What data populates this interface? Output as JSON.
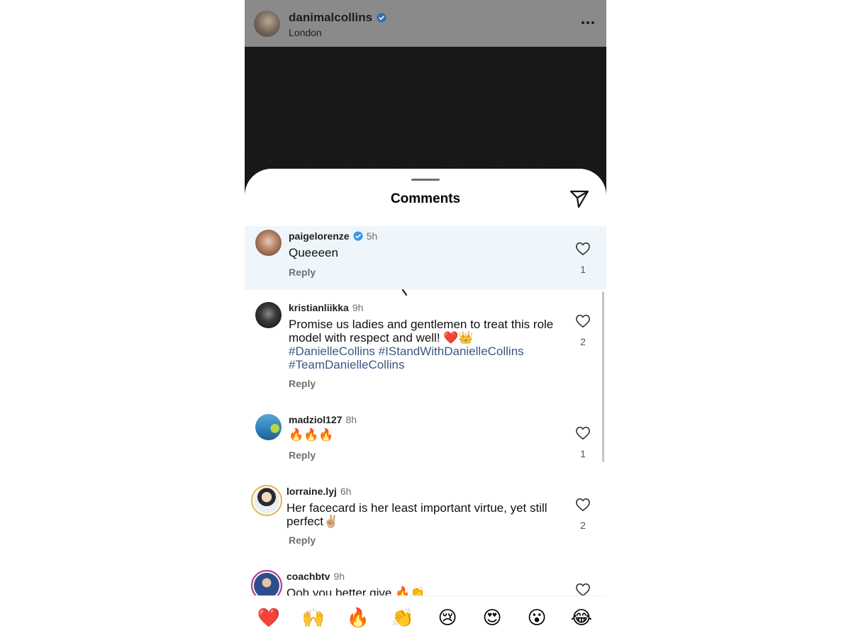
{
  "post": {
    "username": "danimalcollins",
    "location": "London",
    "more_icon": "more-horizontal-icon"
  },
  "sheet": {
    "title": "Comments",
    "share_icon": "paper-plane-icon"
  },
  "comments": [
    {
      "username": "paigelorenze",
      "verified": true,
      "time": "5h",
      "text": "Queeeen",
      "tags": "",
      "reply": "Reply",
      "likes": "1"
    },
    {
      "username": "kristianliikka",
      "verified": false,
      "time": "9h",
      "text": "Promise us ladies and gentlemen to treat this role model with respect and well! ❤️👑",
      "tags": "#DanielleCollins #IStandWithDanielleCollins #TeamDanielleCollins",
      "reply": "Reply",
      "likes": "2"
    },
    {
      "username": "madziol127",
      "verified": false,
      "time": "8h",
      "text": "🔥🔥🔥",
      "tags": "",
      "reply": "Reply",
      "likes": "1"
    },
    {
      "username": "lorraine.lyj",
      "verified": false,
      "time": "6h",
      "text": "Her facecard is her least important virtue, yet still perfect✌🏼",
      "tags": "",
      "reply": "Reply",
      "likes": "2"
    },
    {
      "username": "coachbtv",
      "verified": false,
      "time": "9h",
      "text": "Ooh you better give 🔥👏",
      "tags": "",
      "reply": "",
      "likes": ""
    }
  ],
  "emoji_bar": [
    "❤️",
    "🙌",
    "🔥",
    "👏",
    "😢",
    "😍",
    "😮",
    "😂"
  ],
  "colors": {
    "verified_badge": "#3897f0",
    "hashtag": "#3b5683",
    "highlight_row": "#eff6fb",
    "story_ring": "#e0b840"
  }
}
